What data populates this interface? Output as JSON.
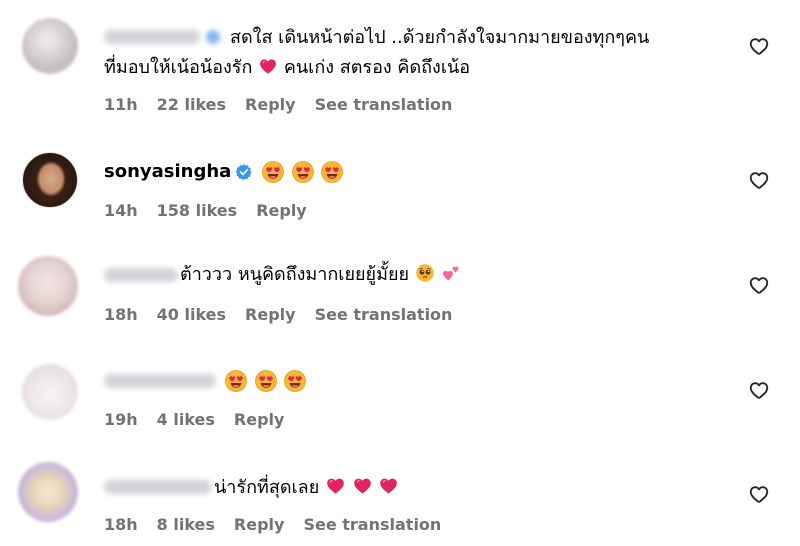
{
  "colors": {
    "meta_text": "#737373",
    "heart_red": "#e0245e",
    "verified_blue": "#3897f0",
    "emoji_yellow": "#f7b731"
  },
  "comments": [
    {
      "username": "",
      "verified": true,
      "text_line1": "สดใส เดินหน้าต่อไป ..ด้วยกำลังใจมากมายของทุกๆคน",
      "text_line2_a": "ที่มอบให้เน้อน้องรัก",
      "text_line2_b": "คนเก่ง สตรอง คิดถึงเน้อ",
      "time": "11h",
      "likes": "22 likes",
      "reply": "Reply",
      "translation": "See translation"
    },
    {
      "username": "sonyasingha",
      "verified": true,
      "text_line1": "",
      "time": "14h",
      "likes": "158 likes",
      "reply": "Reply",
      "translation": ""
    },
    {
      "username": "",
      "verified": false,
      "text_line1": "ต้าววว หนูคิดถึงมากเยยยู้มั้ยย",
      "time": "18h",
      "likes": "40 likes",
      "reply": "Reply",
      "translation": "See translation"
    },
    {
      "username": "",
      "verified": false,
      "text_line1": "",
      "time": "19h",
      "likes": "4 likes",
      "reply": "Reply",
      "translation": ""
    },
    {
      "username": "",
      "verified": false,
      "text_line1": "น่ารักที่สุดเลย",
      "time": "18h",
      "likes": "8 likes",
      "reply": "Reply",
      "translation": "See translation"
    }
  ],
  "icons": {
    "like": "heart-outline-icon",
    "verified": "verified-badge-icon",
    "emoji_heart_eyes": "smiling-face-heart-eyes-icon",
    "emoji_red_heart": "red-heart-icon",
    "emoji_pleading": "pleading-face-icon",
    "emoji_two_hearts": "two-hearts-icon"
  }
}
